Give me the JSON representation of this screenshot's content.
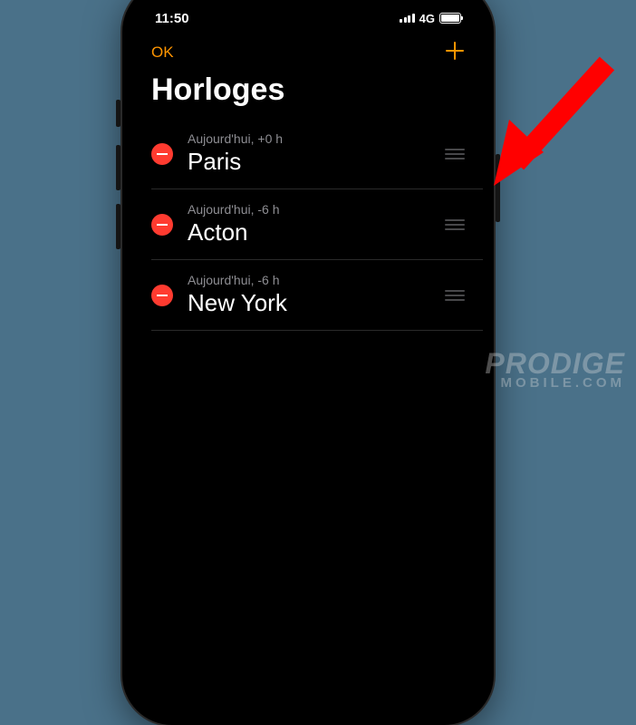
{
  "status": {
    "time": "11:50",
    "network": "4G"
  },
  "nav": {
    "ok_label": "OK"
  },
  "title": "Horloges",
  "clocks": [
    {
      "offset": "Aujourd'hui, +0 h",
      "city": "Paris"
    },
    {
      "offset": "Aujourd'hui, -6 h",
      "city": "Acton"
    },
    {
      "offset": "Aujourd'hui, -6 h",
      "city": "New York"
    }
  ],
  "watermark": {
    "line1": "PRODIGE",
    "line2": "MOBILE.COM"
  },
  "colors": {
    "accent": "#ff9500",
    "delete": "#ff3b30",
    "background": "#4a7189"
  }
}
